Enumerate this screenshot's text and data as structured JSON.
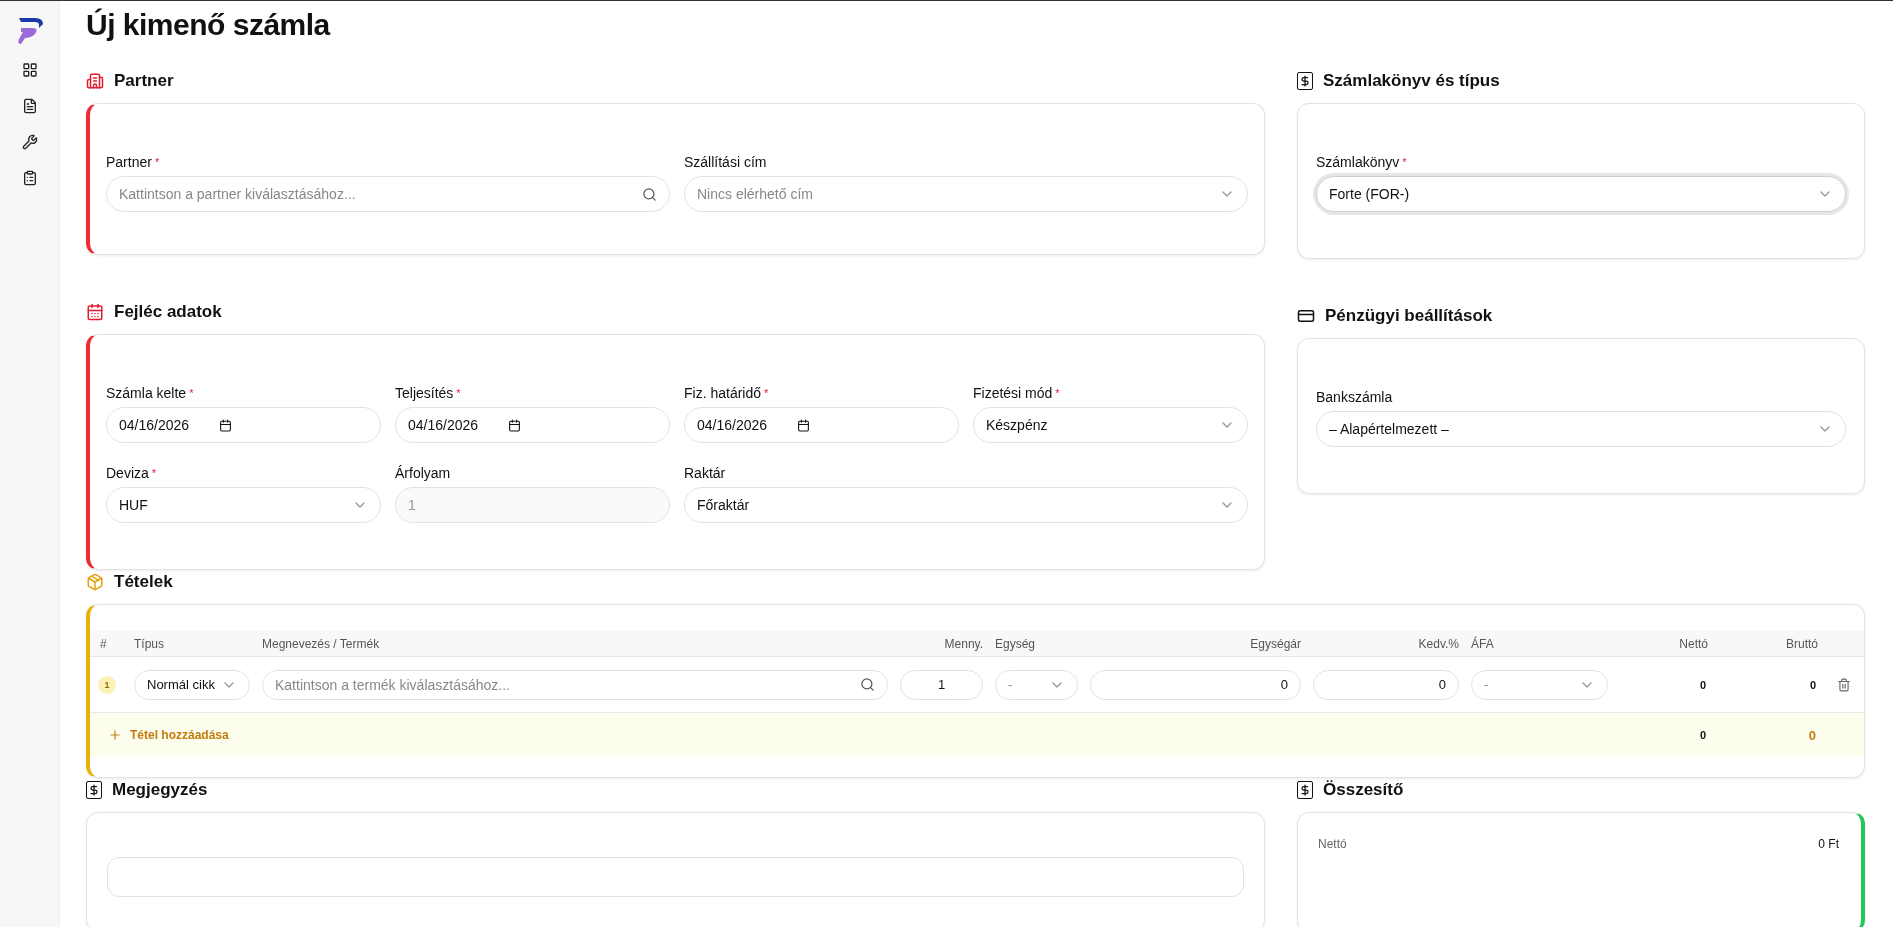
{
  "page_title": "Új kimenő számla",
  "partner": {
    "title": "Partner",
    "fields": [
      {
        "label": "Partner",
        "required_mark": "*",
        "kind": "search",
        "placeholder": "Kattintson a partner kiválasztásához..."
      },
      {
        "label": "Szállítási cím",
        "kind": "select",
        "placeholder": "Nincs elérhető cím"
      }
    ]
  },
  "header_data": {
    "title": "Fejléc adatok",
    "fields": [
      {
        "label": "Számla kelte",
        "required_mark": "*",
        "kind": "date",
        "value": "04/16/2026"
      },
      {
        "label": "Teljesítés",
        "required_mark": "*",
        "kind": "date",
        "value": "04/16/2026"
      },
      {
        "label": "Fiz. határidő",
        "required_mark": "*",
        "kind": "date",
        "value": "04/16/2026"
      },
      {
        "label": "Fizetési mód",
        "required_mark": "*",
        "kind": "select",
        "value": "Készpénz"
      },
      {
        "label": "Deviza",
        "required_mark": "*",
        "kind": "select",
        "value": "HUF"
      },
      {
        "label": "Árfolyam",
        "kind": "input",
        "value": "1",
        "disabled": true
      },
      {
        "label": "Raktár",
        "kind": "select",
        "value": "Főraktár",
        "wide": true
      }
    ]
  },
  "invoice_book": {
    "title": "Számlakönyv és típus",
    "fields": [
      {
        "label": "Számlakönyv",
        "required_mark": "*",
        "kind": "select",
        "value": "Forte (FOR-)",
        "focused": true
      }
    ]
  },
  "finance": {
    "title": "Pénzügyi beállítások",
    "fields": [
      {
        "label": "Bankszámla",
        "kind": "select",
        "value": "– Alapértelmezett –",
        "focused": false
      }
    ]
  },
  "items": {
    "title": "Tételek",
    "columns": [
      "#",
      "Típus",
      "Megnevezés / Termék",
      "Menny.",
      "Egység",
      "Egységár",
      "Kedv.%",
      "ÁFA",
      "Nettó",
      "Bruttó"
    ],
    "rows": [
      {
        "number": "1",
        "type": "Normál cikk",
        "product_placeholder": "Kattintson a termék kiválasztásához...",
        "quantity": "1",
        "unit": "-",
        "unit_price": "0",
        "discount": "0",
        "vat": "-",
        "net": "0",
        "gross": "0"
      }
    ],
    "add_button": "Tétel hozzáadása",
    "total_net": "0",
    "total_gross": "0"
  },
  "note": {
    "title": "Megjegyzés"
  },
  "summary": {
    "title": "Összesítő",
    "rows": [
      {
        "label": "Nettó",
        "value": "0 Ft"
      }
    ]
  }
}
